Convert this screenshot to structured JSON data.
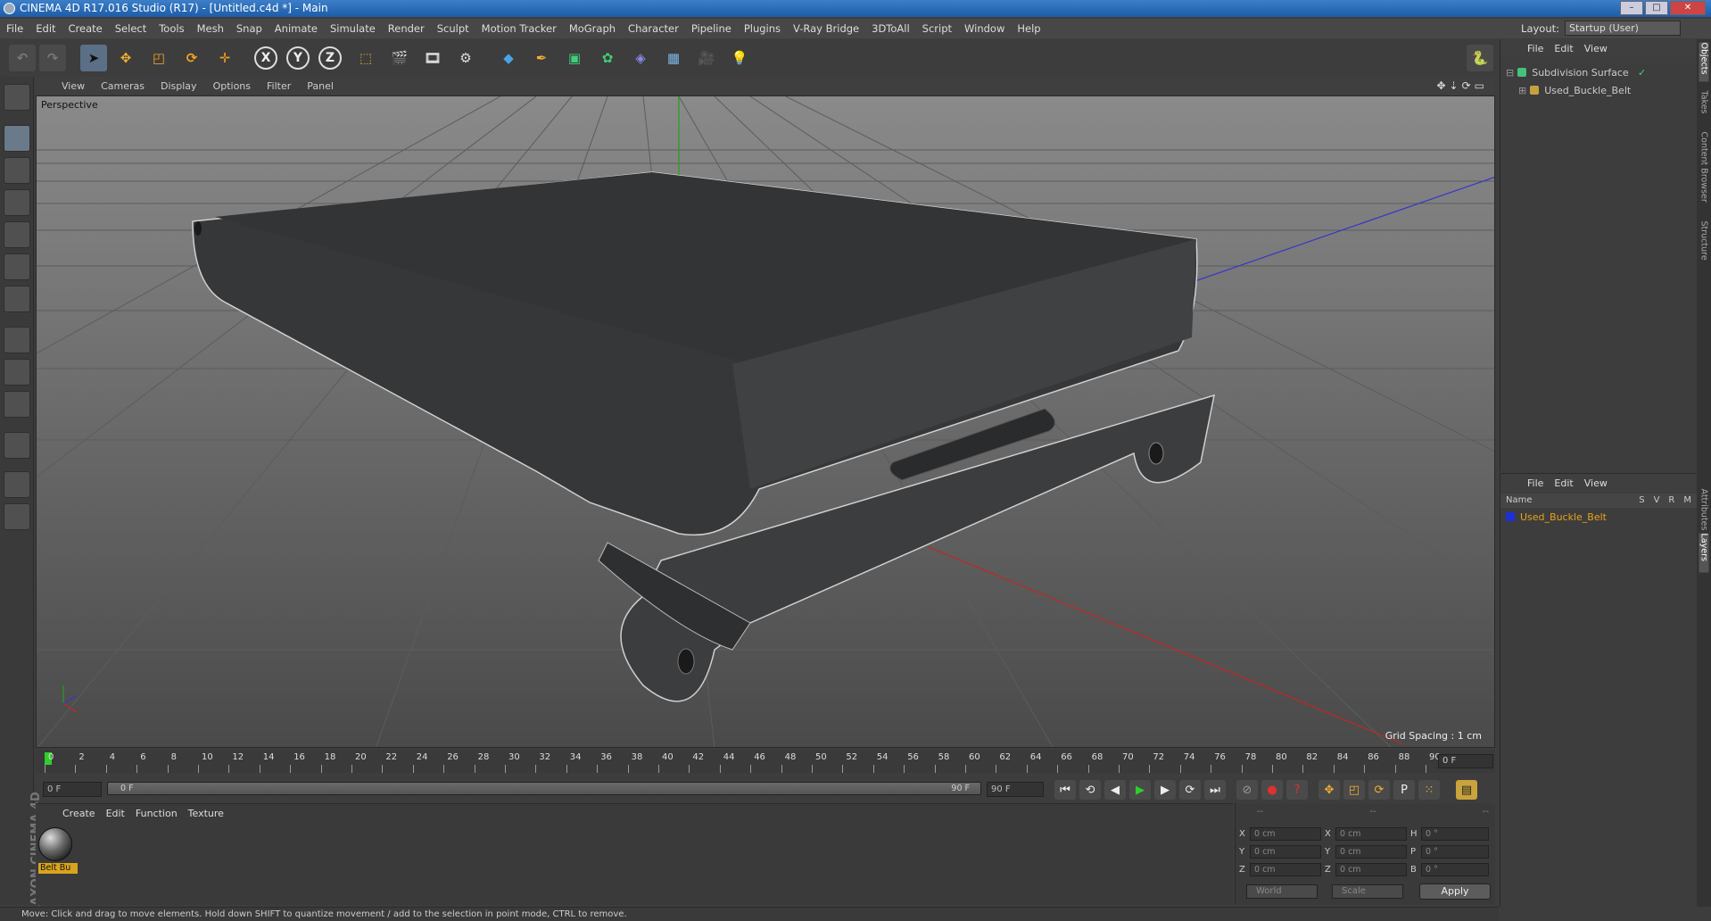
{
  "window": {
    "title": "CINEMA 4D R17.016 Studio (R17) - [Untitled.c4d *] - Main",
    "buttons": [
      "–",
      "□",
      "✕"
    ]
  },
  "menubar": {
    "items": [
      "File",
      "Edit",
      "Create",
      "Select",
      "Tools",
      "Mesh",
      "Snap",
      "Animate",
      "Simulate",
      "Render",
      "Sculpt",
      "Motion Tracker",
      "MoGraph",
      "Character",
      "Pipeline",
      "Plugins",
      "V-Ray Bridge",
      "3DToAll",
      "Script",
      "Window",
      "Help"
    ],
    "layout_label": "Layout:",
    "layout_value": "Startup (User)"
  },
  "toolbar": {
    "axis_x": "X",
    "axis_y": "Y",
    "axis_z": "Z"
  },
  "viewport": {
    "menu": [
      "View",
      "Cameras",
      "Display",
      "Options",
      "Filter",
      "Panel"
    ],
    "label": "Perspective",
    "grid_spacing": "Grid Spacing : 1 cm"
  },
  "timeline": {
    "ticks": [
      "0",
      "2",
      "4",
      "6",
      "8",
      "10",
      "12",
      "14",
      "16",
      "18",
      "20",
      "22",
      "24",
      "26",
      "28",
      "30",
      "32",
      "34",
      "36",
      "38",
      "40",
      "42",
      "44",
      "46",
      "48",
      "50",
      "52",
      "54",
      "56",
      "58",
      "60",
      "62",
      "64",
      "66",
      "68",
      "70",
      "72",
      "74",
      "76",
      "78",
      "80",
      "82",
      "84",
      "86",
      "88",
      "90"
    ],
    "current_frame": "0 F"
  },
  "transport": {
    "start": "0 F",
    "slider_left": "0 F",
    "slider_right": "90 F",
    "end": "90 F"
  },
  "material_manager": {
    "menu": [
      "Create",
      "Edit",
      "Function",
      "Texture"
    ],
    "materials": [
      {
        "label": "Belt Bu"
      }
    ]
  },
  "coordinates": {
    "header": [
      "--",
      "--",
      "--"
    ],
    "rows": [
      {
        "l1": "X",
        "v1": "0 cm",
        "l2": "X",
        "v2": "0 cm",
        "l3": "H",
        "v3": "0 °"
      },
      {
        "l1": "Y",
        "v1": "0 cm",
        "l2": "Y",
        "v2": "0 cm",
        "l3": "P",
        "v3": "0 °"
      },
      {
        "l1": "Z",
        "v1": "0 cm",
        "l2": "Z",
        "v2": "0 cm",
        "l3": "B",
        "v3": "0 °"
      }
    ],
    "mode1": "World",
    "mode2": "Scale",
    "apply": "Apply"
  },
  "object_manager": {
    "menu": [
      "File",
      "Edit",
      "View"
    ],
    "objects": [
      {
        "name": "Subdivision Surface",
        "color": "#44c27a"
      },
      {
        "name": "Used_Buckle_Belt",
        "color": "#c8a040"
      }
    ]
  },
  "layer_manager": {
    "menu": [
      "File",
      "Edit",
      "View"
    ],
    "columns": {
      "name": "Name",
      "s": "S",
      "v": "V",
      "r": "R",
      "m": "M"
    },
    "layers": [
      {
        "name": "Used_Buckle_Belt",
        "color": "#1d2fd6"
      }
    ]
  },
  "side_tabs": [
    "Objects",
    "Takes",
    "Content Browser",
    "Structure",
    "Attributes",
    "Layers"
  ],
  "branding": "MAXON CINEMA 4D",
  "status": "Move: Click and drag to move elements. Hold down SHIFT to quantize movement / add to the selection in point mode, CTRL to remove."
}
